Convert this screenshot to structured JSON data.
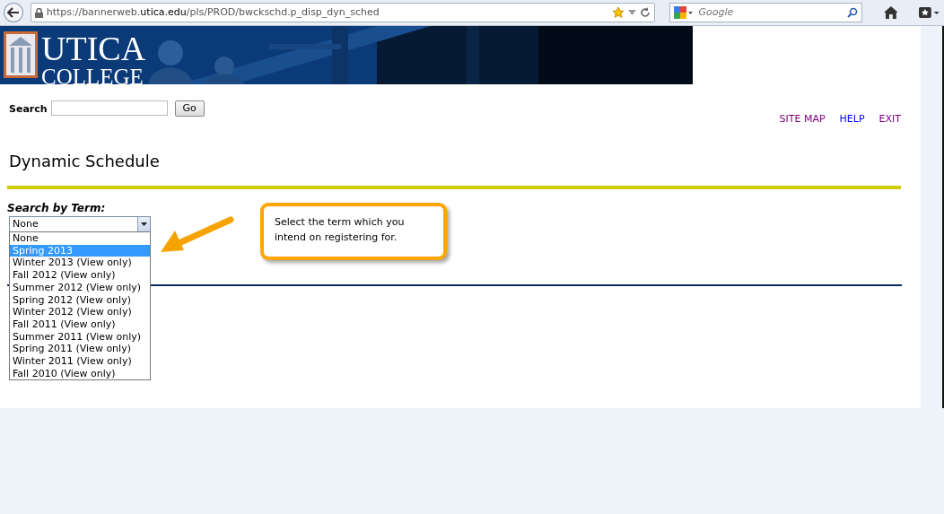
{
  "browser": {
    "url": "https://bannerweb.**utica.edu**/pls/PROD/bwckschd.p_disp_dyn_sched",
    "search_placeholder": "Google"
  },
  "banner": {
    "logo_line_1": "UTICA",
    "logo_line_2": "COLLEGE"
  },
  "search": {
    "label": "Search",
    "button": "Go"
  },
  "links": [
    {
      "label": "SITE MAP",
      "visited": true
    },
    {
      "label": "HELP",
      "visited": false
    },
    {
      "label": "EXIT",
      "visited": true
    }
  ],
  "title": "Dynamic Schedule",
  "term": {
    "label": "Search by Term:",
    "value": "None",
    "expanded": true,
    "options": [
      {
        "label": "None",
        "highlighted": false
      },
      {
        "label": "Spring 2013",
        "highlighted": true
      },
      {
        "label": "Winter 2013 (View only)",
        "highlighted": false
      },
      {
        "label": "Fall 2012 (View only)",
        "highlighted": false
      },
      {
        "label": "Summer 2012 (View only)",
        "highlighted": false
      },
      {
        "label": "Spring 2012 (View only)",
        "highlighted": false
      },
      {
        "label": "Winter 2012 (View only)",
        "highlighted": false
      },
      {
        "label": "Fall 2011 (View only)",
        "highlighted": false
      },
      {
        "label": "Summer 2011 (View only)",
        "highlighted": false
      },
      {
        "label": "Spring 2011 (View only)",
        "highlighted": false
      },
      {
        "label": "Winter 2011 (View only)",
        "highlighted": false
      },
      {
        "label": "Fall 2010 (View only)",
        "highlighted": false
      }
    ]
  },
  "callout": {
    "text": "Select the term which you intend on registering for."
  }
}
